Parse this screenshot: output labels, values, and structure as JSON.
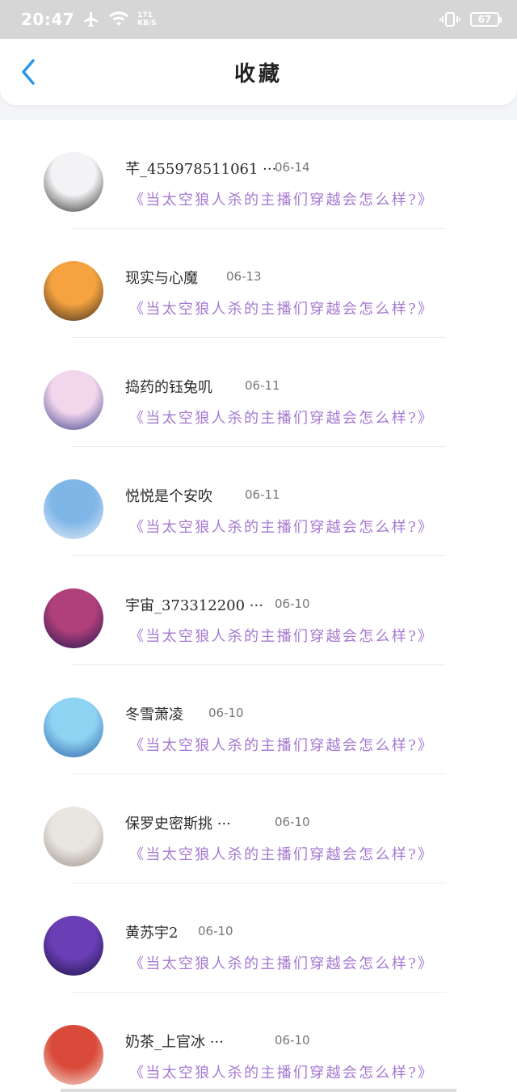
{
  "status_bar": {
    "time": "20:47",
    "speed_value": "171",
    "speed_unit": "KB/S",
    "battery": "67"
  },
  "header": {
    "title": "收藏",
    "back_icon": "chevron-left-icon",
    "accent_color": "#2f97e6"
  },
  "quote_color": "#a57ad1",
  "items": [
    {
      "name": "芊_455978511061 ···",
      "date": "06-14",
      "quote": "《当太空狼人杀的主播们穿越会怎么样?》",
      "avatar_colors": [
        "#f3f3f5",
        "#2b2b2b"
      ]
    },
    {
      "name": "现实与心魔",
      "date": "06-13",
      "quote": "《当太空狼人杀的主播们穿越会怎么样?》",
      "avatar_colors": [
        "#f4a340",
        "#3a2a1c"
      ]
    },
    {
      "name": "捣药的钰兔叽",
      "date": "06-11",
      "quote": "《当太空狼人杀的主播们穿越会怎么样?》",
      "avatar_colors": [
        "#f2d6ec",
        "#3a3f8a"
      ]
    },
    {
      "name": "悦悦是个安吹",
      "date": "06-11",
      "quote": "《当太空狼人杀的主播们穿越会怎么样?》",
      "avatar_colors": [
        "#7fb6e8",
        "#e6eef5"
      ]
    },
    {
      "name": "宇宙_373312200 ···",
      "date": "06-10",
      "quote": "《当太空狼人杀的主播们穿越会怎么样?》",
      "avatar_colors": [
        "#b0407a",
        "#1e1650"
      ]
    },
    {
      "name": "冬雪萧凌",
      "date": "06-10",
      "quote": "《当太空狼人杀的主播们穿越会怎么样?》",
      "avatar_colors": [
        "#8ed3f2",
        "#2c5fa6"
      ]
    },
    {
      "name": "保罗史密斯挑 ···",
      "date": "06-10",
      "quote": "《当太空狼人杀的主播们穿越会怎么样?》",
      "avatar_colors": [
        "#e9e6e2",
        "#9c8f86"
      ]
    },
    {
      "name": "黄苏宇2",
      "date": "06-10",
      "quote": "《当太空狼人杀的主播们穿越会怎么样?》",
      "avatar_colors": [
        "#6a3fb6",
        "#1a1240"
      ]
    },
    {
      "name": "奶茶_上官冰 ···",
      "date": "06-10",
      "quote": "《当太空狼人杀的主播们穿越会怎么样?》",
      "avatar_colors": [
        "#d94a3a",
        "#f2e6dc"
      ]
    }
  ]
}
